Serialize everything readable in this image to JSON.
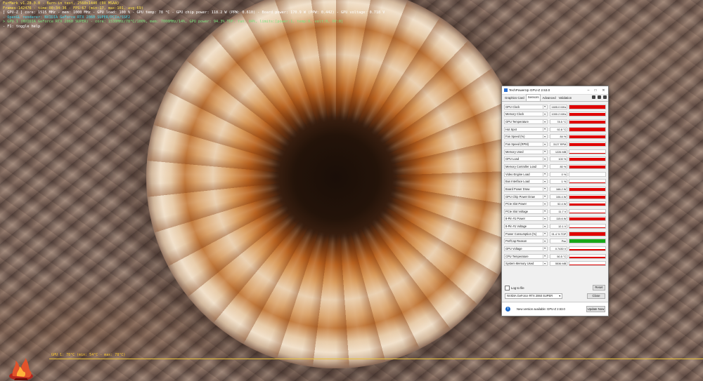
{
  "osd": {
    "lines": [
      {
        "text": "FurMark v1.28.0.0 - Burn-in test, 2560x1440 (0X MSAA)",
        "color": "y"
      },
      {
        "text": "Frames:142476 - time:00:34:36 - FPS:67 (min:17, max:101, avg:69)",
        "color": "y"
      },
      {
        "text": "[ GPU-Z ] core: 1515 MHz - mem: 1000 MHz - GPU load: 100 % - GPU temp: 78 °C - GPU chip power: 118.2 W (PPW: 0.610) - Board power: 170.9 W (PPW: 0.442) - GPU voltage: 0.718 V",
        "color": "w"
      },
      {
        "text": "- OpenGL renderer: NVIDIA GeForce RTX 2060 SUPER/PCIe/SSE2",
        "color": "c"
      },
      {
        "text": "> GPU 1 (NVIDIA GeForce RTX 2060 SUPER) - core: 1530MHz/78°C/100%, mem: 7000MHz/14%, GPU power: 94.3% TDP, fan: 84%, limits:[power:1, temp:0, volt:0, OV:0]",
        "color": "g"
      },
      {
        "text": "- F1: toggle help",
        "color": "w"
      }
    ]
  },
  "graph": {
    "label": "GPU 1: 78°C (min: 54°C - max: 78°C)"
  },
  "gpuz": {
    "title": "TechPowerUp GPU-Z 2.53.0",
    "tabs": [
      "Graphics Card",
      "Sensors",
      "Advanced",
      "Validation"
    ],
    "active_tab": "Sensors",
    "sensors": [
      {
        "label": "GPU Clock",
        "value": "1605.0 MHz",
        "fill": 0.9,
        "color": "#e00000"
      },
      {
        "label": "Memory Clock",
        "value": "1000.2 MHz",
        "fill": 0.85,
        "color": "#e00000"
      },
      {
        "label": "GPU Temperature",
        "value": "78.5 °C",
        "fill": 0.8,
        "color": "#e00000"
      },
      {
        "label": "Hot Spot",
        "value": "92.8 °C",
        "fill": 0.85,
        "color": "#e00000"
      },
      {
        "label": "Fan Speed (%)",
        "value": "84 %",
        "fill": 0.8,
        "color": "#e00000"
      },
      {
        "label": "Fan Speed (RPM)",
        "value": "3127 RPM",
        "fill": 0.8,
        "color": "#e00000"
      },
      {
        "label": "Memory Used",
        "value": "1226 MB",
        "fill": 0.15,
        "color": "#e00000"
      },
      {
        "label": "GPU Load",
        "value": "100 %",
        "fill": 0.95,
        "color": "#e00000"
      },
      {
        "label": "Memory Controller Load",
        "value": "80 %",
        "fill": 0.75,
        "color": "#e00000"
      },
      {
        "label": "Video Engine Load",
        "value": "0 %",
        "fill": 0.0,
        "color": "#e00000"
      },
      {
        "label": "Bus Interface Load",
        "value": "1 %",
        "fill": 0.02,
        "color": "#e00000"
      },
      {
        "label": "Board Power Draw",
        "value": "168.2 W",
        "fill": 0.85,
        "color": "#e00000"
      },
      {
        "label": "GPU Chip Power Draw",
        "value": "106.4 W",
        "fill": 0.75,
        "color": "#e00000"
      },
      {
        "label": "PCIe Slot Power",
        "value": "52.4 W",
        "fill": 0.7,
        "color": "#e00000"
      },
      {
        "label": "PCIe Slot Voltage",
        "value": "11.7 V",
        "fill": 0.2,
        "color": "#e00000"
      },
      {
        "label": "8-Pin #1 Power",
        "value": "115.6 W",
        "fill": 0.8,
        "color": "#e00000"
      },
      {
        "label": "8-Pin #1 Voltage",
        "value": "12.1 V",
        "fill": 0.2,
        "color": "#e00000"
      },
      {
        "label": "Power Consumption (%)",
        "value": "91.4 % TDP",
        "fill": 0.85,
        "color": "#e00000"
      },
      {
        "label": "PerfCap Reason",
        "value": "Pwr",
        "fill": 1.0,
        "color": "#18a818"
      },
      {
        "label": "GPU Voltage",
        "value": "0.7430 V",
        "fill": 0.35,
        "color": "#e00000"
      },
      {
        "label": "CPU Temperature",
        "value": "50.5 °C",
        "fill": 0.3,
        "color": "#e00000"
      },
      {
        "label": "System Memory Used",
        "value": "5536 MB",
        "fill": 0.3,
        "color": "#e00000"
      }
    ],
    "log_label": "Log to file",
    "reset_label": "Reset",
    "gpu_select": "NVIDIA GeForce RTX 2060 SUPER",
    "close_label": "Close",
    "notice_text": "New version available: GPU-Z 2.53.0",
    "update_label": "Update Now"
  }
}
